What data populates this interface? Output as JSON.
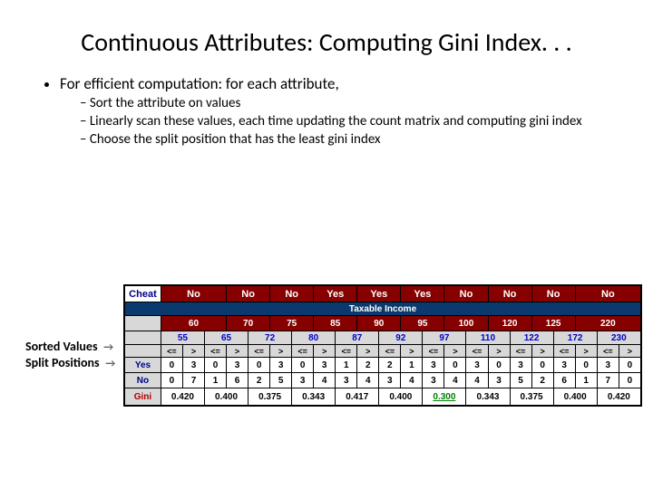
{
  "title": "Continuous Attributes: Computing Gini Index. . .",
  "bullet_main": "For efficient computation: for each attribute,",
  "sub_bullets": [
    "Sort the attribute on values",
    "Linearly scan these values, each time updating the count matrix and computing gini index",
    "Choose the split position that has the least gini index"
  ],
  "side_labels": {
    "sorted": "Sorted Values",
    "split": "Split Positions"
  },
  "table": {
    "cheat_label": "Cheat",
    "cheat_values": [
      "No",
      "No",
      "No",
      "Yes",
      "Yes",
      "Yes",
      "No",
      "No",
      "No",
      "No"
    ],
    "tax_header": "Taxable Income",
    "sorted_values": [
      "60",
      "70",
      "75",
      "85",
      "90",
      "95",
      "100",
      "120",
      "125",
      "220"
    ],
    "split_values": [
      "55",
      "65",
      "72",
      "80",
      "87",
      "92",
      "97",
      "110",
      "122",
      "172",
      "230"
    ],
    "leq": "<=",
    "gt": ">",
    "yes_label": "Yes",
    "no_label": "No",
    "yes_counts": [
      [
        0,
        3
      ],
      [
        0,
        3
      ],
      [
        0,
        3
      ],
      [
        0,
        3
      ],
      [
        1,
        2
      ],
      [
        2,
        1
      ],
      [
        3,
        0
      ],
      [
        3,
        0
      ],
      [
        3,
        0
      ],
      [
        3,
        0
      ],
      [
        3,
        0
      ]
    ],
    "no_counts": [
      [
        0,
        7
      ],
      [
        1,
        6
      ],
      [
        2,
        5
      ],
      [
        3,
        4
      ],
      [
        3,
        4
      ],
      [
        3,
        4
      ],
      [
        3,
        4
      ],
      [
        4,
        3
      ],
      [
        5,
        2
      ],
      [
        6,
        1
      ],
      [
        7,
        0
      ]
    ],
    "gini_label": "Gini",
    "gini_values": [
      "0.420",
      "0.400",
      "0.375",
      "0.343",
      "0.417",
      "0.400",
      "0.300",
      "0.343",
      "0.375",
      "0.400",
      "0.420"
    ],
    "gini_min_index": 6
  }
}
